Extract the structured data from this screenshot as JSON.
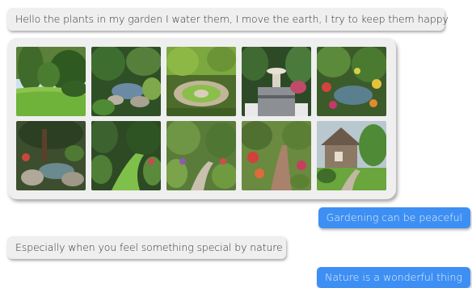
{
  "messages": [
    {
      "id": "msg1",
      "side": "left",
      "text": "Hello the plants in my garden  I water them, I move the earth, I try to keep them happy"
    },
    {
      "id": "msg2",
      "side": "right",
      "text": "Gardening  can be peaceful"
    },
    {
      "id": "msg3",
      "side": "left",
      "text": "Especially when you feel something special by nature"
    },
    {
      "id": "msg4",
      "side": "right",
      "text": "Nature is a wonderful thing"
    }
  ],
  "gallery": {
    "images": [
      {
        "name": "garden-photo-1",
        "kind": "lawn"
      },
      {
        "name": "garden-photo-2",
        "kind": "pond-rocks"
      },
      {
        "name": "garden-photo-3",
        "kind": "round-patio"
      },
      {
        "name": "garden-photo-4",
        "kind": "fountain-patio"
      },
      {
        "name": "garden-photo-5",
        "kind": "flower-pond"
      },
      {
        "name": "garden-photo-6",
        "kind": "rock-pond-tree"
      },
      {
        "name": "garden-photo-7",
        "kind": "lawn-path"
      },
      {
        "name": "garden-photo-8",
        "kind": "gravel-path"
      },
      {
        "name": "garden-photo-9",
        "kind": "brick-path"
      },
      {
        "name": "garden-photo-10",
        "kind": "house-garden"
      }
    ]
  },
  "colors": {
    "incoming_bg": "#efefef",
    "outgoing_bg": "#3d8ff3"
  }
}
